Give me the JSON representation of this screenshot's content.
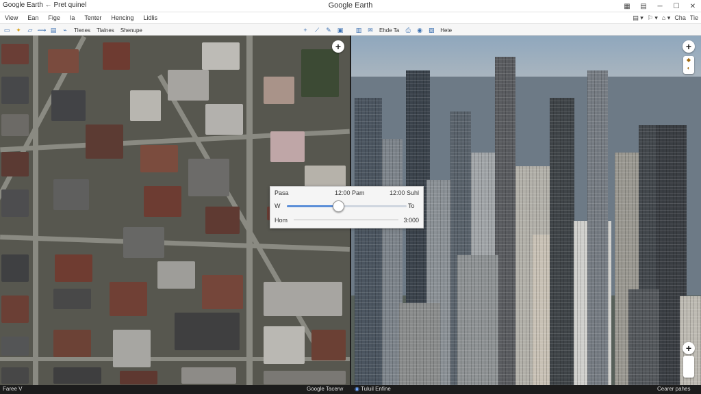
{
  "titlebar": {
    "left_text": "Google Earth ← Pret quinel",
    "title": "Google Earth",
    "controls": [
      "▦",
      "▤",
      "─",
      "☐",
      "✕"
    ]
  },
  "menubar": {
    "items": [
      "View",
      "Ean",
      "Fige",
      "Ia",
      "Tenter",
      "Hencing",
      "Lidlis"
    ],
    "right_items": [
      "▤ ▾",
      "⚐ ▾",
      "⌂ ▾",
      "Cha",
      "Tie"
    ]
  },
  "toolbar": {
    "left_labels": [
      "Tlenes",
      "Tlalnes",
      "Shenupe"
    ],
    "right_labels": [
      "Ehde Ta",
      "Hete"
    ]
  },
  "time_panel": {
    "top_left": "Pasa",
    "top_mid": "12:00 Pam",
    "top_right": "12:00 Suhl",
    "slider_left": "W",
    "slider_right": "To",
    "slider_value": 0.43,
    "bottom_left": "Hom",
    "bottom_right": "3:000"
  },
  "statusbar": {
    "left": "Faree V",
    "mid": "Google Tacerw",
    "right_left": "Tuluil Enfine",
    "right": "Cearer pahes"
  }
}
